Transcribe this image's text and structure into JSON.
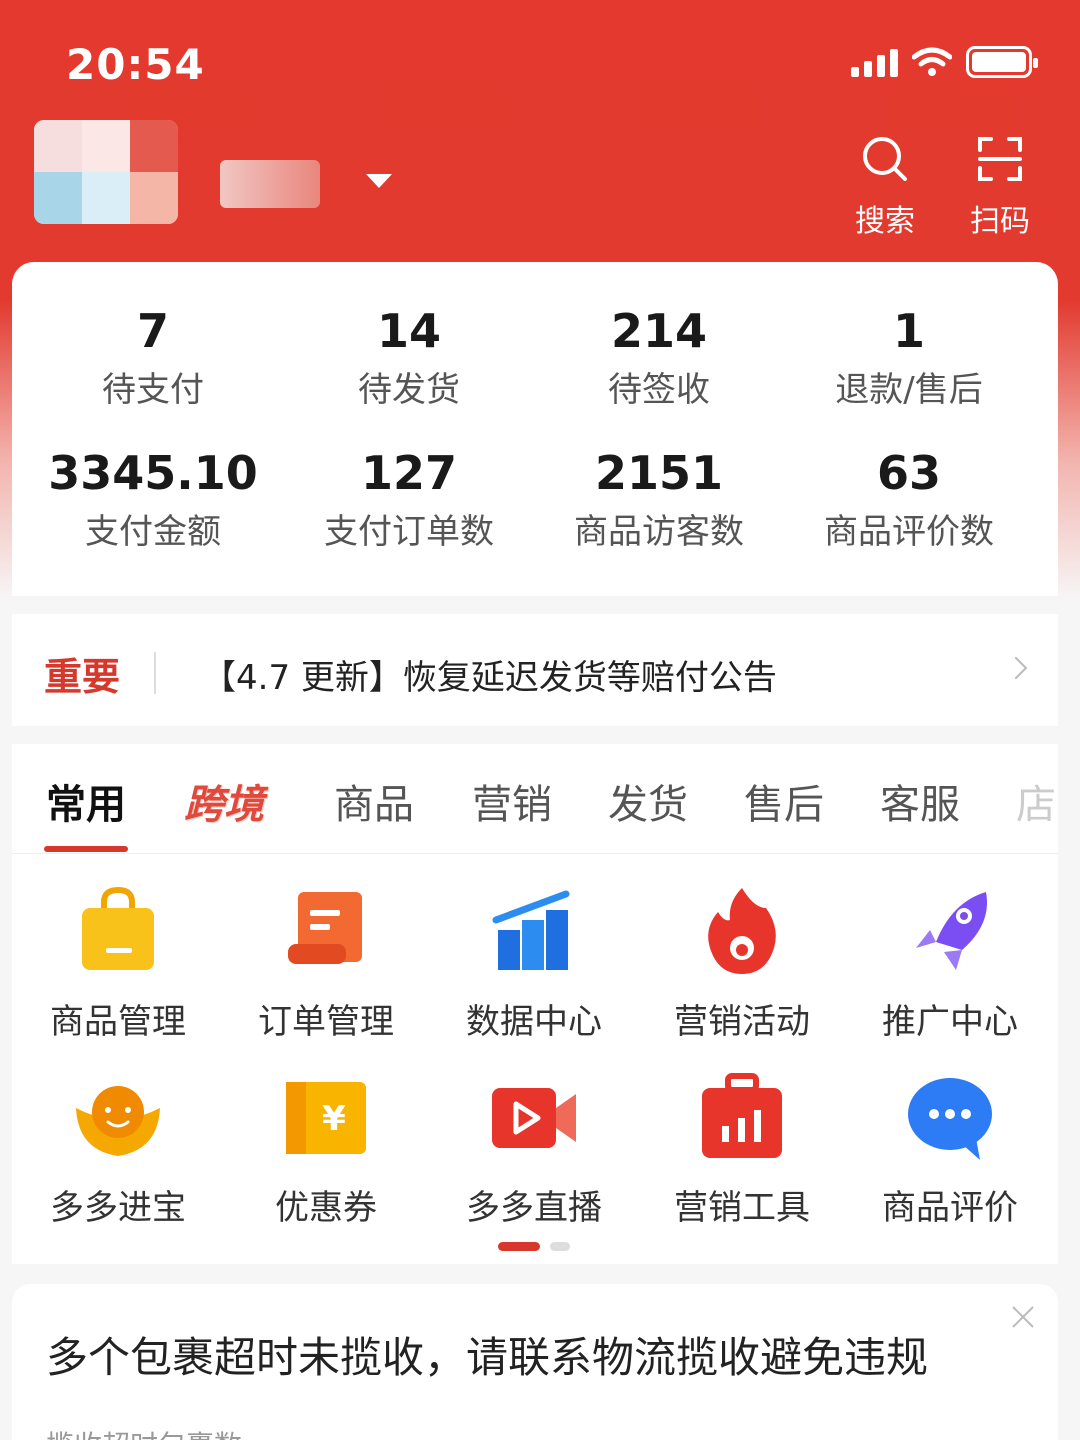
{
  "status_bar": {
    "time": "20:54"
  },
  "header": {
    "search_label": "搜索",
    "scan_label": "扫码"
  },
  "stats": {
    "row1": [
      {
        "value": "7",
        "label": "待支付"
      },
      {
        "value": "14",
        "label": "待发货"
      },
      {
        "value": "214",
        "label": "待签收"
      },
      {
        "value": "1",
        "label": "退款/售后"
      }
    ],
    "row2": [
      {
        "value": "3345.10",
        "label": "支付金额"
      },
      {
        "value": "127",
        "label": "支付订单数"
      },
      {
        "value": "2151",
        "label": "商品访客数"
      },
      {
        "value": "63",
        "label": "商品评价数"
      }
    ]
  },
  "notice": {
    "tag": "重要",
    "text": "【4.7 更新】恢复延迟发货等赔付公告"
  },
  "tabs": [
    {
      "label": "常用"
    },
    {
      "label": "跨境"
    },
    {
      "label": "商品"
    },
    {
      "label": "营销"
    },
    {
      "label": "发货"
    },
    {
      "label": "售后"
    },
    {
      "label": "客服"
    },
    {
      "label": "店"
    }
  ],
  "tools": [
    {
      "label": "商品管理",
      "icon": "shopping-bag-icon"
    },
    {
      "label": "订单管理",
      "icon": "order-scroll-icon"
    },
    {
      "label": "数据中心",
      "icon": "bar-chart-icon"
    },
    {
      "label": "营销活动",
      "icon": "flame-icon"
    },
    {
      "label": "推广中心",
      "icon": "rocket-icon"
    },
    {
      "label": "多多进宝",
      "icon": "ingot-icon"
    },
    {
      "label": "优惠券",
      "icon": "coupon-icon"
    },
    {
      "label": "多多直播",
      "icon": "live-video-icon"
    },
    {
      "label": "营销工具",
      "icon": "toolbox-icon"
    },
    {
      "label": "商品评价",
      "icon": "chat-bubble-icon"
    }
  ],
  "pager": {
    "current": 1,
    "total": 2
  },
  "alert": {
    "title": "多个包裹超时未揽收，请联系物流揽收避免违规",
    "subtitle": "揽收超时包裹数"
  },
  "colors": {
    "brand_red": "#e23a2f",
    "accent_red": "#d6382c"
  }
}
